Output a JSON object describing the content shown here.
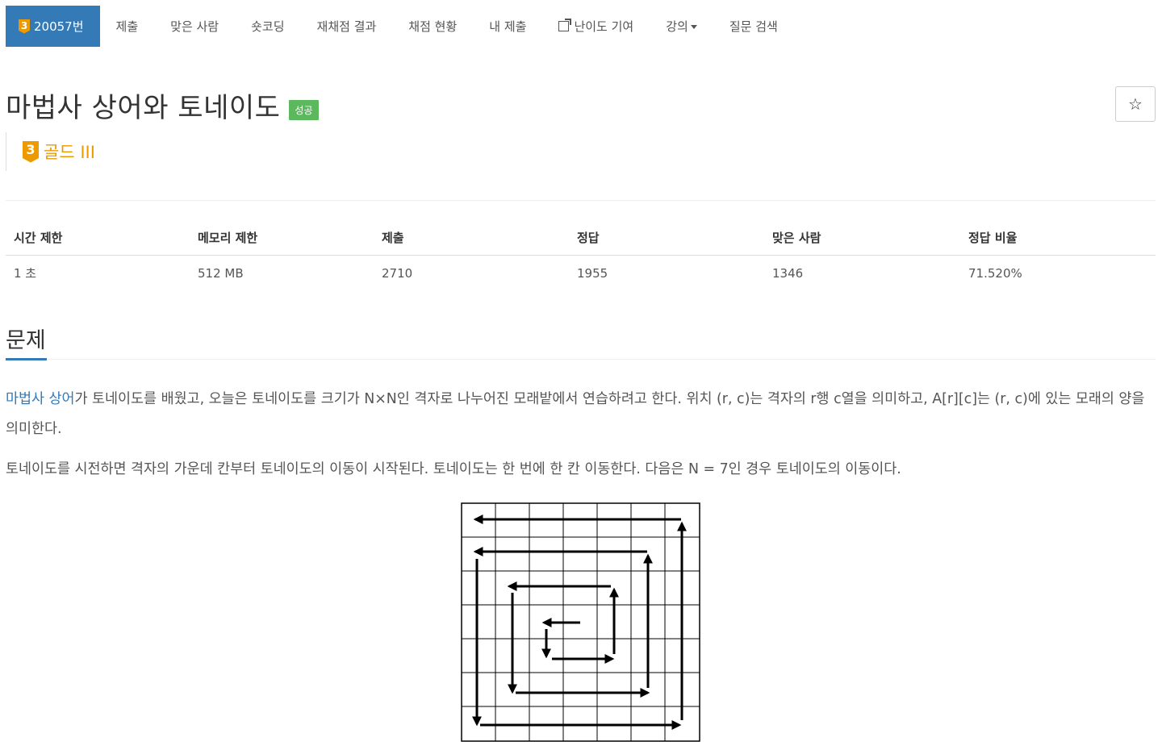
{
  "nav": {
    "problem_id": "20057번",
    "tier_num": "3",
    "items": [
      {
        "label": "제출",
        "name": "nav-submit"
      },
      {
        "label": "맞은 사람",
        "name": "nav-correct-users"
      },
      {
        "label": "숏코딩",
        "name": "nav-short-coding"
      },
      {
        "label": "재채점 결과",
        "name": "nav-rejudge-result"
      },
      {
        "label": "채점 현황",
        "name": "nav-judge-status"
      },
      {
        "label": "내 제출",
        "name": "nav-my-submissions"
      }
    ],
    "difficulty_label": "난이도 기여",
    "lecture_label": "강의",
    "search_label": "질문 검색"
  },
  "problem": {
    "title": "마법사 상어와 토네이도",
    "status": "성공",
    "star": "☆",
    "tier_num": "3",
    "tier_label": "골드 III"
  },
  "table": {
    "headers": [
      "시간 제한",
      "메모리 제한",
      "제출",
      "정답",
      "맞은 사람",
      "정답 비율"
    ],
    "values": [
      "1 초",
      "512 MB",
      "2710",
      "1955",
      "1346",
      "71.520%"
    ]
  },
  "section": {
    "heading": "문제",
    "p1_link": "마법사 상어",
    "p1_text": "가 토네이도를 배웠고, 오늘은 토네이도를 크기가 N×N인 격자로 나누어진 모래밭에서 연습하려고 한다. 위치 (r, c)는 격자의 r행 c열을 의미하고, A[r][c]는 (r, c)에 있는 모래의 양을 의미한다.",
    "p2_text": "토네이도를 시전하면 격자의 가운데 칸부터 토네이도의 이동이 시작된다. 토네이도는 한 번에 한 칸 이동한다. 다음은 N = 7인 경우 토네이도의 이동이다."
  },
  "colors": {
    "nav_active": "#337ab7",
    "tier_gold": "#ec9a00",
    "success": "#5cb85c"
  }
}
